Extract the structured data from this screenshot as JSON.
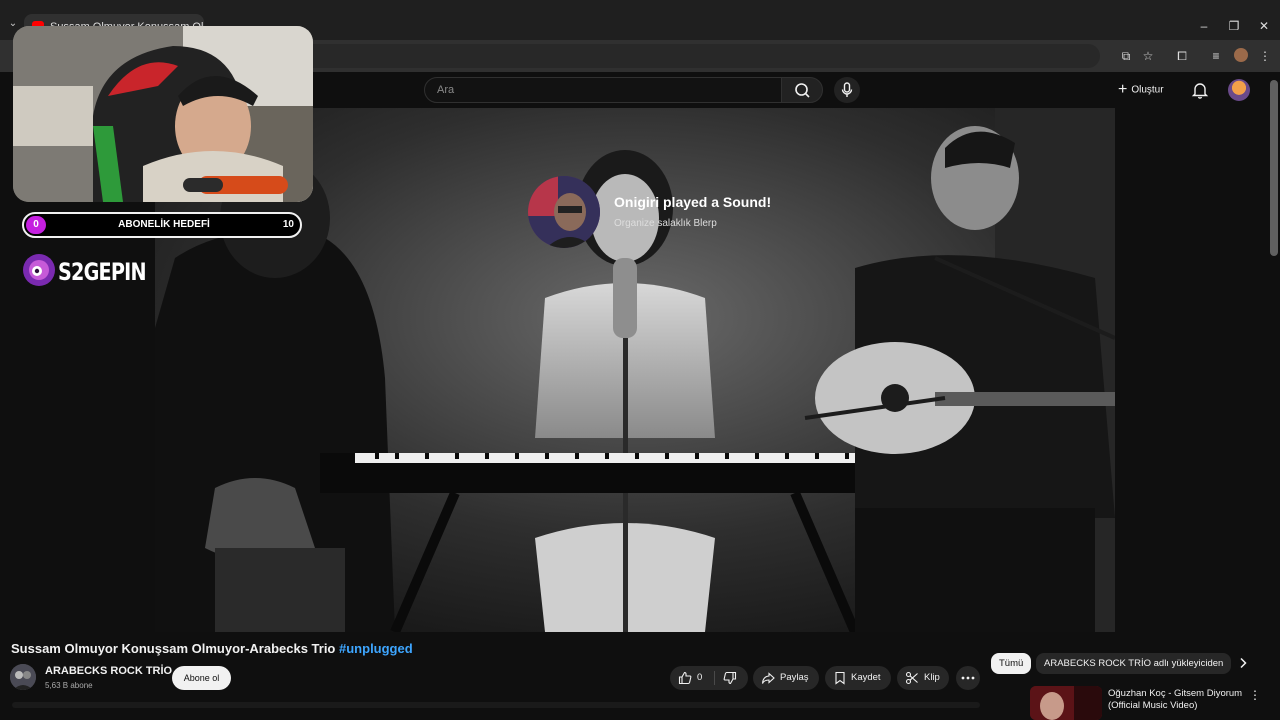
{
  "browser": {
    "tab_title": "Sussam Olmuyor Konuşsam Olmuyor - YouTube",
    "window_controls": [
      "minimize",
      "restore",
      "close"
    ]
  },
  "header": {
    "search_placeholder": "Ara",
    "create_label": "Oluştur"
  },
  "overlay": {
    "goal_start": "0",
    "goal_label": "ABONELİK HEDEFİ",
    "goal_end": "10",
    "logo_text": "S2GEPIN",
    "alert_title": "Onigiri played a Sound!",
    "alert_subtitle": "Organize salaklık Blerp"
  },
  "video": {
    "title": "Sussam Olmuyor Konuşsam Olmuyor-Arabecks Trio",
    "hashtag": "#unplugged"
  },
  "channel": {
    "name": "ARABECKS ROCK TRİO",
    "subscribers": "5,63 B abone",
    "subscribe_label": "Abone ol"
  },
  "actions": {
    "like_count": "0",
    "share_label": "Paylaş",
    "save_label": "Kaydet",
    "clip_label": "Klip"
  },
  "chips": {
    "all_label": "Tümü",
    "uploader_label": "ARABECKS ROCK TRİO adlı yükleyiciden"
  },
  "recommendation": {
    "title": "Oğuzhan Koç - Gitsem Diyorum (Official Music Video)"
  },
  "colors": {
    "background": "#0f0f0f",
    "link_blue": "#3ea6ff",
    "goal_purple": "#c51fe0"
  }
}
